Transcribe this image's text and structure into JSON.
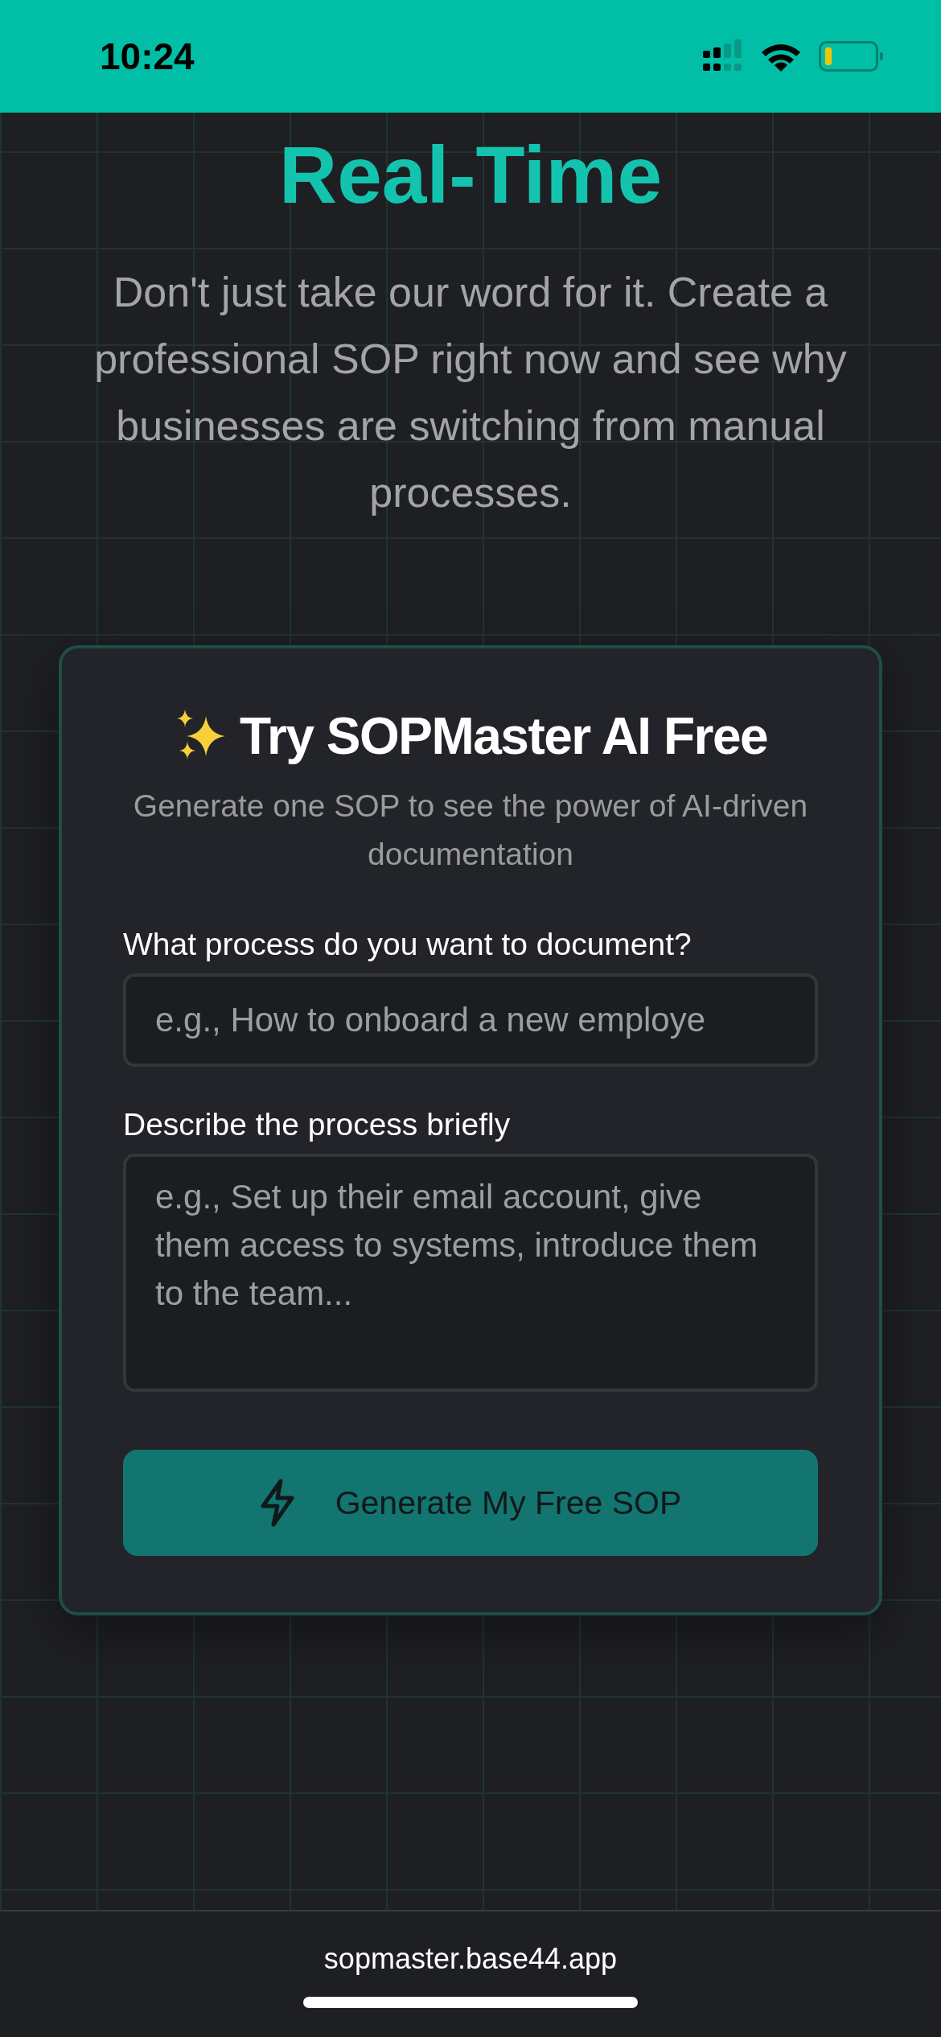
{
  "status_bar": {
    "time": "10:24"
  },
  "hero": {
    "title": "Real-Time",
    "description": "Don't just take our word for it. Create a professional SOP right now and see why businesses are switching from manual processes."
  },
  "card": {
    "title": "Try SOPMaster AI Free",
    "subtitle": "Generate one SOP to see the power of AI-driven documentation",
    "fields": [
      {
        "kind": "input",
        "label": "What process do you want to document?",
        "placeholder": "e.g., How to onboard a new employe"
      },
      {
        "kind": "textarea",
        "label": "Describe the process briefly",
        "placeholder": "e.g., Set up their email account, give them access to systems, introduce them to the team..."
      }
    ],
    "button": "Generate My Free SOP"
  },
  "browser_bar": {
    "url": "sopmaster.base44.app"
  }
}
